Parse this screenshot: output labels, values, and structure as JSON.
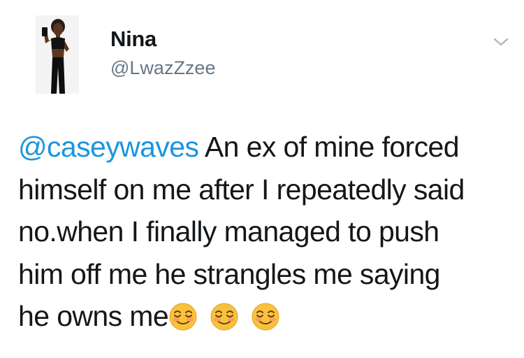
{
  "user": {
    "display_name": "Nina",
    "handle": "@LwazZzee"
  },
  "tweet": {
    "mention": "@caseywaves",
    "line1_rest": "An ex of mine forced",
    "line2": "himself on me after I repeatedly said",
    "line3": "no.when I finally managed to push",
    "line4": "him off me he strangles me saying",
    "line5": "he owns me",
    "emojis": [
      "smiling-face",
      "smiling-face",
      "smiling-face"
    ]
  },
  "icons": {
    "menu": "chevron-down-icon"
  },
  "colors": {
    "text": "#14171a",
    "secondary": "#657786",
    "link": "#1b95e0",
    "emoji_face": "#f9c23c"
  }
}
